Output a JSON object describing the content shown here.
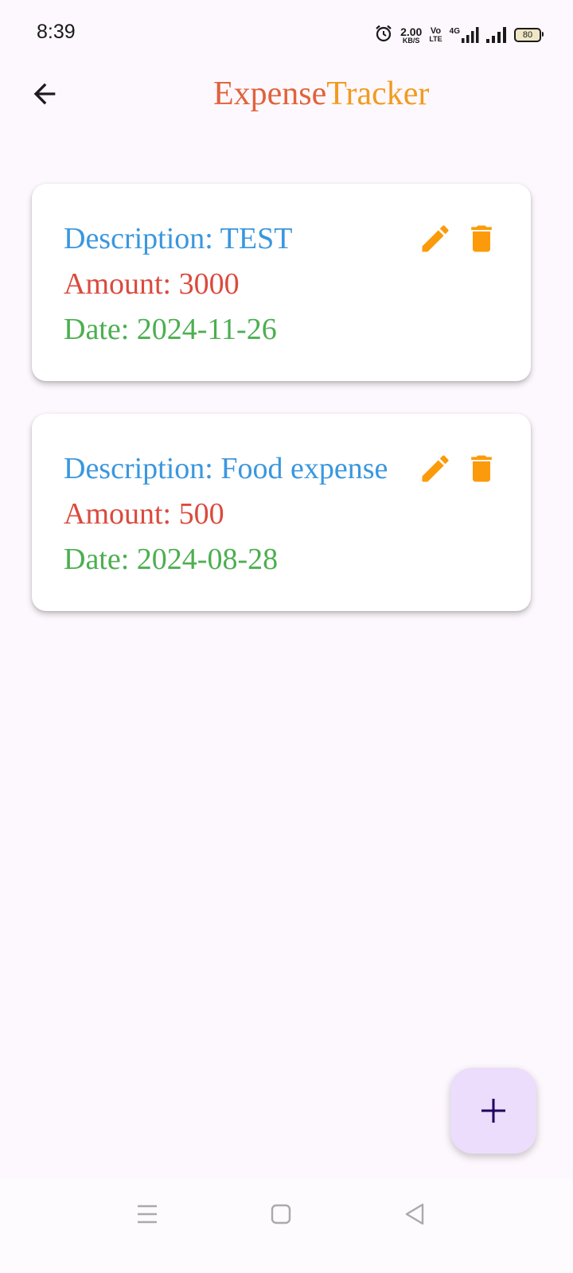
{
  "status_bar": {
    "time": "8:39",
    "speed_value": "2.00",
    "speed_unit": "KB/S",
    "volte_top": "Vo",
    "volte_bottom": "LTE",
    "network_label": "4G",
    "battery": "80"
  },
  "app_bar": {
    "title_part1": "Expense",
    "title_part2": "Tracker",
    "title_color_1": "#e0623c",
    "title_color_2": "#f29a1f"
  },
  "expenses": [
    {
      "description": "Description: TEST",
      "amount": "Amount: 3000",
      "date": "Date: 2024-11-26"
    },
    {
      "description": "Description: Food expense",
      "amount": "Amount: 500",
      "date": "Date: 2024-08-28"
    }
  ],
  "colors": {
    "description": "#3a97de",
    "amount": "#db4a3e",
    "date": "#4caf50",
    "action_icons": "#fb9b0c",
    "fab_background": "#ebddfb",
    "fab_icon": "#21005d"
  },
  "icons": {
    "back": "arrow-left-icon",
    "edit": "pencil-icon",
    "delete": "trash-icon",
    "add": "plus-icon"
  }
}
